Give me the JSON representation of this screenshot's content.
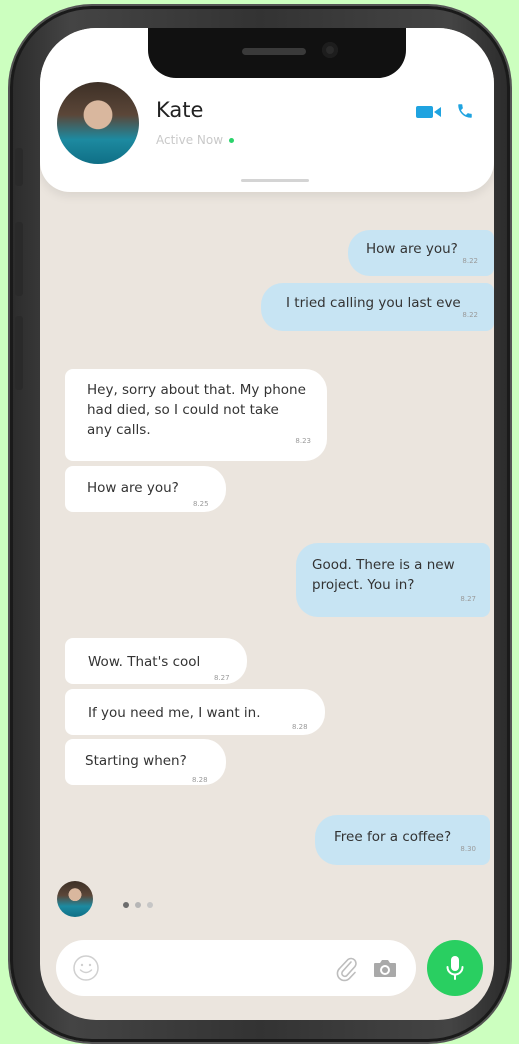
{
  "contact": {
    "name": "Kate",
    "status": "Active Now"
  },
  "colors": {
    "accent": "#1fa3e0",
    "outgoing_bubble": "#c7e4f3",
    "incoming_bubble": "#ffffff",
    "online": "#2bd36b",
    "mic_button": "#29cf61",
    "chat_background": "#ebe5de"
  },
  "icons": {
    "video_call": "video-camera-icon",
    "voice_call": "phone-icon",
    "emoji": "smiley-icon",
    "attach": "paperclip-icon",
    "camera": "camera-icon",
    "mic": "microphone-icon"
  },
  "messages": [
    {
      "direction": "out",
      "text": "How are you?",
      "time": "8.22"
    },
    {
      "direction": "out",
      "text": "I tried calling you last eve",
      "time": "8.22"
    },
    {
      "direction": "in",
      "text": "Hey, sorry about that. My phone\nhad died, so I could not take\nany calls.",
      "time": "8.23"
    },
    {
      "direction": "in",
      "text": "How are you?",
      "time": "8.25"
    },
    {
      "direction": "out",
      "text": "Good. There is a new\nproject. You in?",
      "time": "8.27"
    },
    {
      "direction": "in",
      "text": "Wow. That's cool",
      "time": "8.27"
    },
    {
      "direction": "in",
      "text": "If you need me, I want in.",
      "time": "8.28"
    },
    {
      "direction": "in",
      "text": "Starting when?",
      "time": "8.28"
    },
    {
      "direction": "out",
      "text": "Free for a coffee?",
      "time": "8.30"
    }
  ],
  "composer": {
    "value": "",
    "placeholder": ""
  }
}
